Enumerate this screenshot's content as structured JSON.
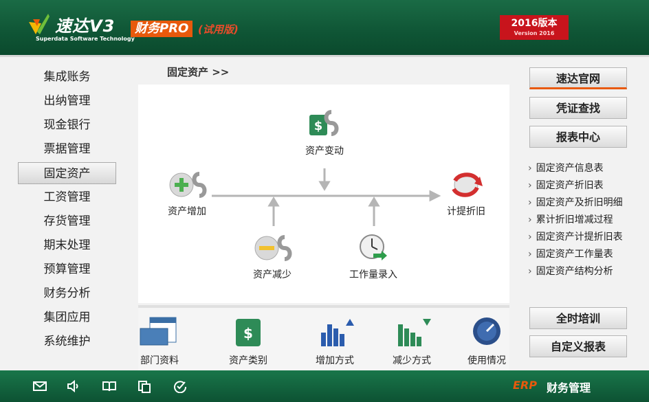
{
  "header": {
    "brand_name": "速达V3",
    "brand_sub": "Superdata Software Technology",
    "product": "财务PRO",
    "trial": "(试用版)",
    "version_line1": "2016版本",
    "version_line2": "Version 2016"
  },
  "sidebar": {
    "items": [
      {
        "label": "集成账务"
      },
      {
        "label": "出纳管理"
      },
      {
        "label": "现金银行"
      },
      {
        "label": "票据管理"
      },
      {
        "label": "固定资产"
      },
      {
        "label": "工资管理"
      },
      {
        "label": "存货管理"
      },
      {
        "label": "期末处理"
      },
      {
        "label": "预算管理"
      },
      {
        "label": "财务分析"
      },
      {
        "label": "集团应用"
      },
      {
        "label": "系统维护"
      }
    ],
    "active_index": 4
  },
  "breadcrumb": "固定资产 >>",
  "flow": {
    "change": "资产变动",
    "add": "资产增加",
    "depreciate": "计提折旧",
    "reduce": "资产减少",
    "workload": "工作量录入"
  },
  "tools": {
    "dept": "部门资料",
    "category": "资产类别",
    "add_method": "增加方式",
    "reduce_method": "减少方式",
    "usage": "使用情况"
  },
  "right": {
    "website": "速达官网",
    "voucher": "凭证查找",
    "report_center": "报表中心",
    "links": [
      "固定资产信息表",
      "固定资产折旧表",
      "固定资产及折旧明细",
      "累计折旧增减过程",
      "固定资产计提折旧表",
      "固定资产工作量表",
      "固定资产结构分析"
    ],
    "training": "全时培训",
    "custom_report": "自定义报表"
  },
  "footer": {
    "erp": "ERP",
    "title": "财务管理"
  },
  "colors": {
    "header_green": "#0f5535",
    "accent_orange": "#e8590c",
    "version_red": "#c8141c"
  }
}
